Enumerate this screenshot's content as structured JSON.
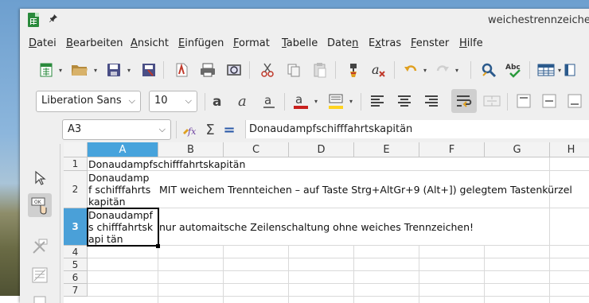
{
  "window": {
    "title": "weichestrennzeichen"
  },
  "menu": [
    "Datei",
    "Bearbeiten",
    "Ansicht",
    "Einfügen",
    "Format",
    "Tabelle",
    "Daten",
    "Extras",
    "Fenster",
    "Hilfe"
  ],
  "menu_underline": [
    "D",
    "B",
    "A",
    "E",
    "F",
    "T",
    "n",
    "x",
    "F",
    "H"
  ],
  "toolbar_font": {
    "name": "Liberation Sans",
    "size": "10"
  },
  "formula_bar": {
    "cell_ref": "A3",
    "sum_symbol": "Σ",
    "equals_symbol": "=",
    "content": "Donaudampfschifffahrtskapitän"
  },
  "grid": {
    "columns": [
      "A",
      "B",
      "C",
      "D",
      "E",
      "F",
      "G",
      "H"
    ],
    "rows": [
      "1",
      "2",
      "3",
      "4",
      "5",
      "6",
      "7"
    ],
    "selected_column": "A",
    "selected_row": "3",
    "cells": {
      "A1": "Donaudampfschifffahrtskapitän",
      "A2": "Donaudampf schifffahrts kapitän",
      "B2": "MIT weichem Trennteichen – auf Taste Strg+AltGr+9 (Alt+]) gelegtem Tastenkürzel",
      "A3": "Donaudampfs chifffahrtskapi tän",
      "B3": "nur automaitsche Zeilenschaltung ohne weiches Trennzeichen!"
    }
  },
  "icons": [
    "new-spreadsheet-icon",
    "open-folder-icon",
    "save-icon",
    "export-pdf-icon",
    "export-directly-pdf-icon",
    "print-icon",
    "print-preview-icon",
    "cut-icon",
    "copy-icon",
    "paste-icon",
    "clone-formatting-icon",
    "clear-formatting-icon",
    "undo-icon",
    "redo-icon",
    "find-replace-icon",
    "spellcheck-icon",
    "row-icon",
    "column-icon",
    "bold-icon",
    "italic-icon",
    "underline-icon",
    "font-color-icon",
    "highlight-color-icon",
    "align-left-icon",
    "align-center-icon",
    "align-right-icon",
    "wrap-text-icon",
    "merge-cells-icon",
    "align-top-icon",
    "align-middle-icon",
    "align-bottom-icon",
    "function-wizard-icon",
    "sum-icon",
    "formula-icon",
    "select-icon",
    "form-control-icon",
    "design-mode-icon",
    "control-properties-icon",
    "properties-icon"
  ]
}
